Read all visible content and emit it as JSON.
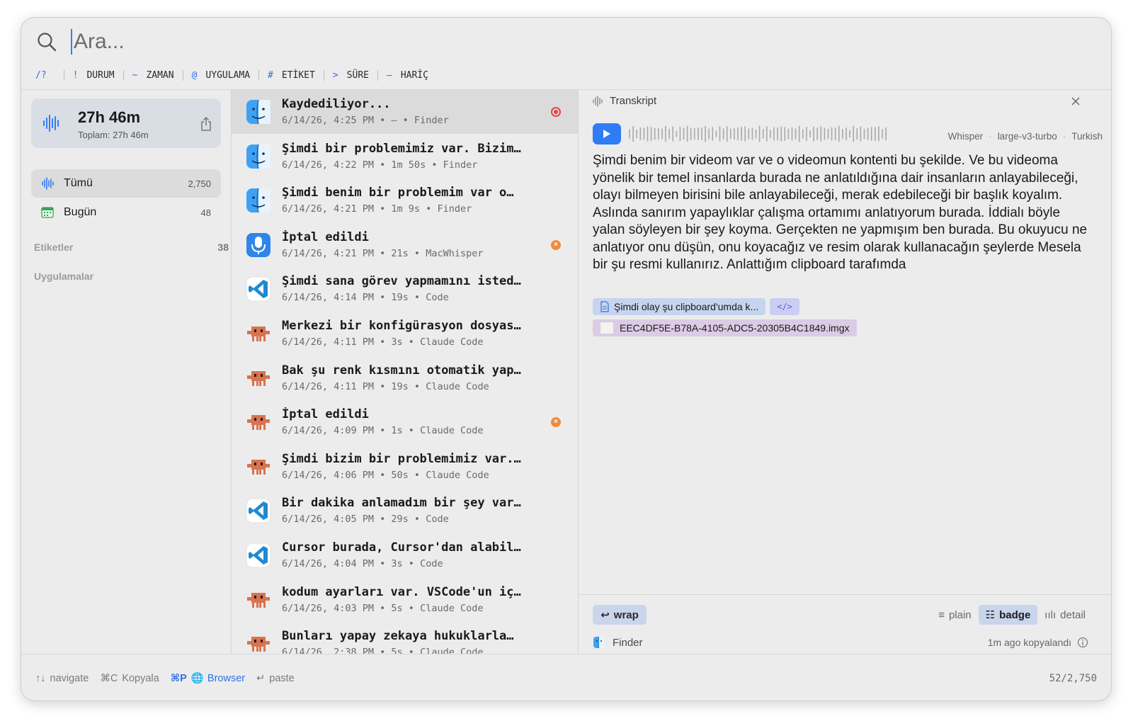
{
  "search": {
    "placeholder": "Ara..."
  },
  "filters": [
    {
      "symbol": "/?",
      "label": ""
    },
    {
      "symbol": "!",
      "label": "DURUM"
    },
    {
      "symbol": "~",
      "label": "ZAMAN"
    },
    {
      "symbol": "@",
      "label": "UYGULAMA"
    },
    {
      "symbol": "#",
      "label": "ETİKET"
    },
    {
      "symbol": ">",
      "label": "SÜRE"
    },
    {
      "symbol": "–",
      "label": "HARİÇ"
    }
  ],
  "sidebar": {
    "total_value": "27h 46m",
    "total_sub": "Toplam: 27h 46m",
    "items": [
      {
        "label": "Tümü",
        "count": "2,750",
        "icon": "waveform-icon"
      },
      {
        "label": "Bugün",
        "count": "48",
        "icon": "calendar-icon"
      }
    ],
    "sections": [
      {
        "label": "Etiketler",
        "count": "38"
      },
      {
        "label": "Uygulamalar",
        "count": ""
      }
    ]
  },
  "list": [
    {
      "title": "Kaydediliyor...",
      "meta": "6/14/26, 4:25 PM • — • Finder",
      "app": "finder",
      "status": "recording"
    },
    {
      "title": "Şimdi bir problemimiz var. Bizim…",
      "meta": "6/14/26, 4:22 PM • 1m 50s • Finder",
      "app": "finder",
      "status": ""
    },
    {
      "title": "Şimdi benim bir problemim var o…",
      "meta": "6/14/26, 4:21 PM • 1m 9s • Finder",
      "app": "finder",
      "status": ""
    },
    {
      "title": "İptal edildi",
      "meta": "6/14/26, 4:21 PM • 21s • MacWhisper",
      "app": "macwhisper",
      "status": "cancelled"
    },
    {
      "title": "Şimdi sana görev yapmamını isted…",
      "meta": "6/14/26, 4:14 PM • 19s • Code",
      "app": "vscode",
      "status": ""
    },
    {
      "title": "Merkezi bir konfigürasyon dosyas…",
      "meta": "6/14/26, 4:11 PM • 3s • Claude Code",
      "app": "claude",
      "status": ""
    },
    {
      "title": "Bak şu renk kısmını otomatik yap…",
      "meta": "6/14/26, 4:11 PM • 19s • Claude Code",
      "app": "claude",
      "status": ""
    },
    {
      "title": "İptal edildi",
      "meta": "6/14/26, 4:09 PM • 1s • Claude Code",
      "app": "claude",
      "status": "cancelled"
    },
    {
      "title": "Şimdi bizim bir problemimiz var.…",
      "meta": "6/14/26, 4:06 PM • 50s • Claude Code",
      "app": "claude",
      "status": ""
    },
    {
      "title": "Bir dakika anlamadım bir şey var…",
      "meta": "6/14/26, 4:05 PM • 29s • Code",
      "app": "vscode",
      "status": ""
    },
    {
      "title": "Cursor burada, Cursor'dan alabil…",
      "meta": "6/14/26, 4:04 PM • 3s • Code",
      "app": "vscode",
      "status": ""
    },
    {
      "title": "kodum ayarları var. VSCode'un iç…",
      "meta": "6/14/26, 4:03 PM • 5s • Claude Code",
      "app": "claude",
      "status": ""
    },
    {
      "title": "Bunları yapay zekaya hukuklarla…",
      "meta": "6/14/26, 2:38 PM • 5s • Claude Code",
      "app": "claude",
      "status": ""
    }
  ],
  "detail": {
    "title": "Transkript",
    "model_tags": [
      "Whisper",
      "large-v3-turbo",
      "Turkish"
    ],
    "transcript": "Şimdi benim bir videom var ve o videomun kontenti bu şekilde. Ve bu videoma yönelik bir temel insanlarda burada ne anlatıldığına dair insanların anlayabileceği, olayı bilmeyen birisini bile anlayabileceği, merak edebileceği bir başlık koyalım. Aslında sanırım yapaylıklar çalışma ortamımı anlatıyorum burada. İddialı böyle yalan söyleyen bir şey koyma. Gerçekten ne yapmışım ben burada. Bu okuyucu ne anlatıyor onu düşün, onu koyacağız ve resim olarak kullanacağın şeylerde Mesela bir şu resmi kullanırız. Anlattığım clipboard tarafımda",
    "attachment_text": "Şimdi olay şu clipboard'umda k...",
    "attachment_code": "</>",
    "attachment_image": "EEC4DF5E-B78A-4105-ADC5-20305B4C1849.imgx",
    "wrap_label": "wrap",
    "view_modes": [
      "plain",
      "badge",
      "detail"
    ],
    "active_view": "badge",
    "source_app": "Finder",
    "copied_text": "1m ago kopyalandı"
  },
  "footer": {
    "hints": [
      {
        "key": "↑↓",
        "label": "navigate"
      },
      {
        "key": "⌘C",
        "label": "Kopyala"
      },
      {
        "key": "⌘P",
        "label": "Browser"
      },
      {
        "key": "↵",
        "label": "paste"
      }
    ],
    "counter": "52/2,750"
  },
  "colors": {
    "accent": "#2f7cf6",
    "recording": "#e84545",
    "cancelled": "#f08a3c",
    "claude": "#d9734e"
  }
}
